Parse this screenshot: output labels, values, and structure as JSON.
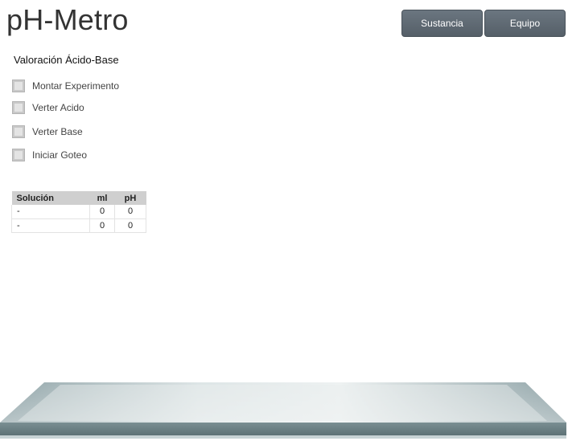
{
  "app": {
    "title": "pH-Metro"
  },
  "header": {
    "buttons": [
      {
        "label": "Sustancia"
      },
      {
        "label": "Equipo"
      }
    ]
  },
  "experiment": {
    "title": "Valoración Ácido-Base",
    "steps": [
      {
        "label": "Montar Experimento",
        "checked": false
      },
      {
        "label": "Verter Acido",
        "checked": false
      },
      {
        "label": "Verter Base",
        "checked": false
      },
      {
        "label": "Iniciar Goteo",
        "checked": false
      }
    ]
  },
  "table": {
    "headers": [
      "Solución",
      "ml",
      "pH"
    ],
    "rows": [
      [
        "-",
        "0",
        "0"
      ],
      [
        "-",
        "0",
        "0"
      ]
    ]
  },
  "colors": {
    "button_bg": "#5f6a73",
    "bench_top": "#9fb2b6",
    "bench_front": "#6d8286"
  }
}
